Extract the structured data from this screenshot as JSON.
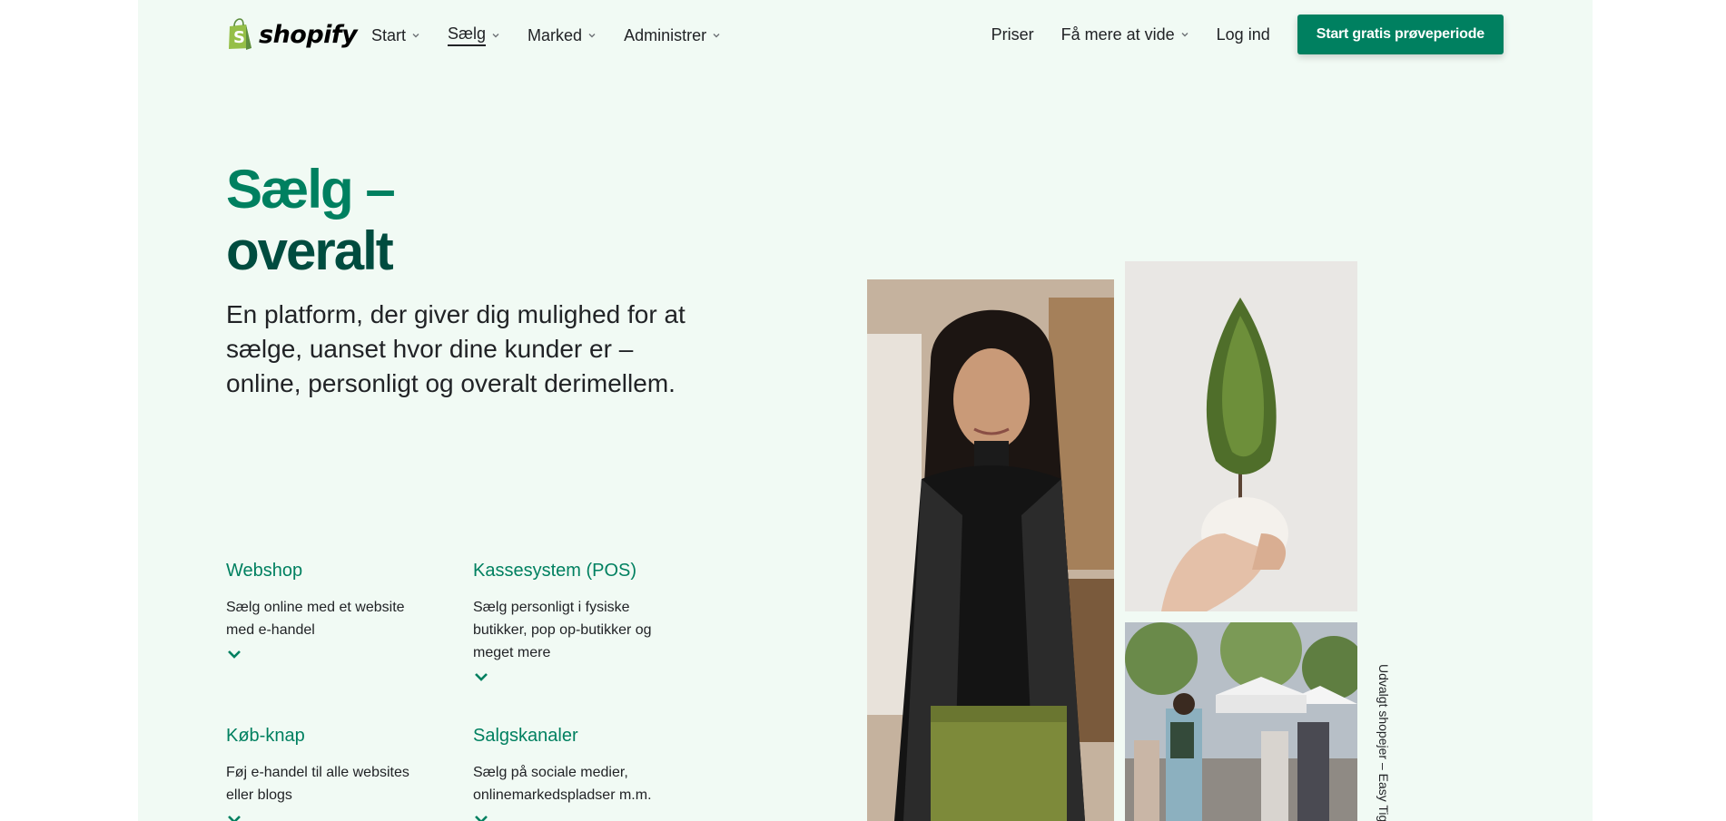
{
  "brand": {
    "name": "shopify",
    "accent": "#008060",
    "dark": "#004c3f",
    "background": "#f1faf4"
  },
  "nav": {
    "left": [
      {
        "label": "Start",
        "active": false
      },
      {
        "label": "Sælg",
        "active": true
      },
      {
        "label": "Marked",
        "active": false
      },
      {
        "label": "Administrer",
        "active": false
      }
    ],
    "pricing": "Priser",
    "learn_more": "Få mere at vide",
    "login": "Log ind",
    "cta": "Start gratis prøveperiode"
  },
  "hero": {
    "title_line1": "Sælg –",
    "title_line2": "overalt",
    "subtitle": "En platform, der giver dig mulighed for at sælge, uanset hvor dine kunder er – online, personligt og overalt derimellem."
  },
  "features": [
    {
      "title": "Webshop",
      "desc": "Sælg online med et website med e-handel"
    },
    {
      "title": "Kassesystem (POS)",
      "desc": "Sælg personligt i fysiske butikker, pop op-butikker og meget mere"
    },
    {
      "title": "Køb-knap",
      "desc": "Føj e-handel til alle websites eller blogs"
    },
    {
      "title": "Salgskanaler",
      "desc": "Sælg på sociale medier, onlinemarkedspladser m.m."
    }
  ],
  "images": [
    {
      "name": "merchant-portrait",
      "subject": "smiling woman with long dark hair in a shop"
    },
    {
      "name": "plant-in-hand",
      "subject": "hand holding a small tree in a pot"
    },
    {
      "name": "street-market",
      "subject": "outdoor street market with white tents and shoppers"
    }
  ],
  "caption": "Udvalgt shopejer – Easy Tig"
}
